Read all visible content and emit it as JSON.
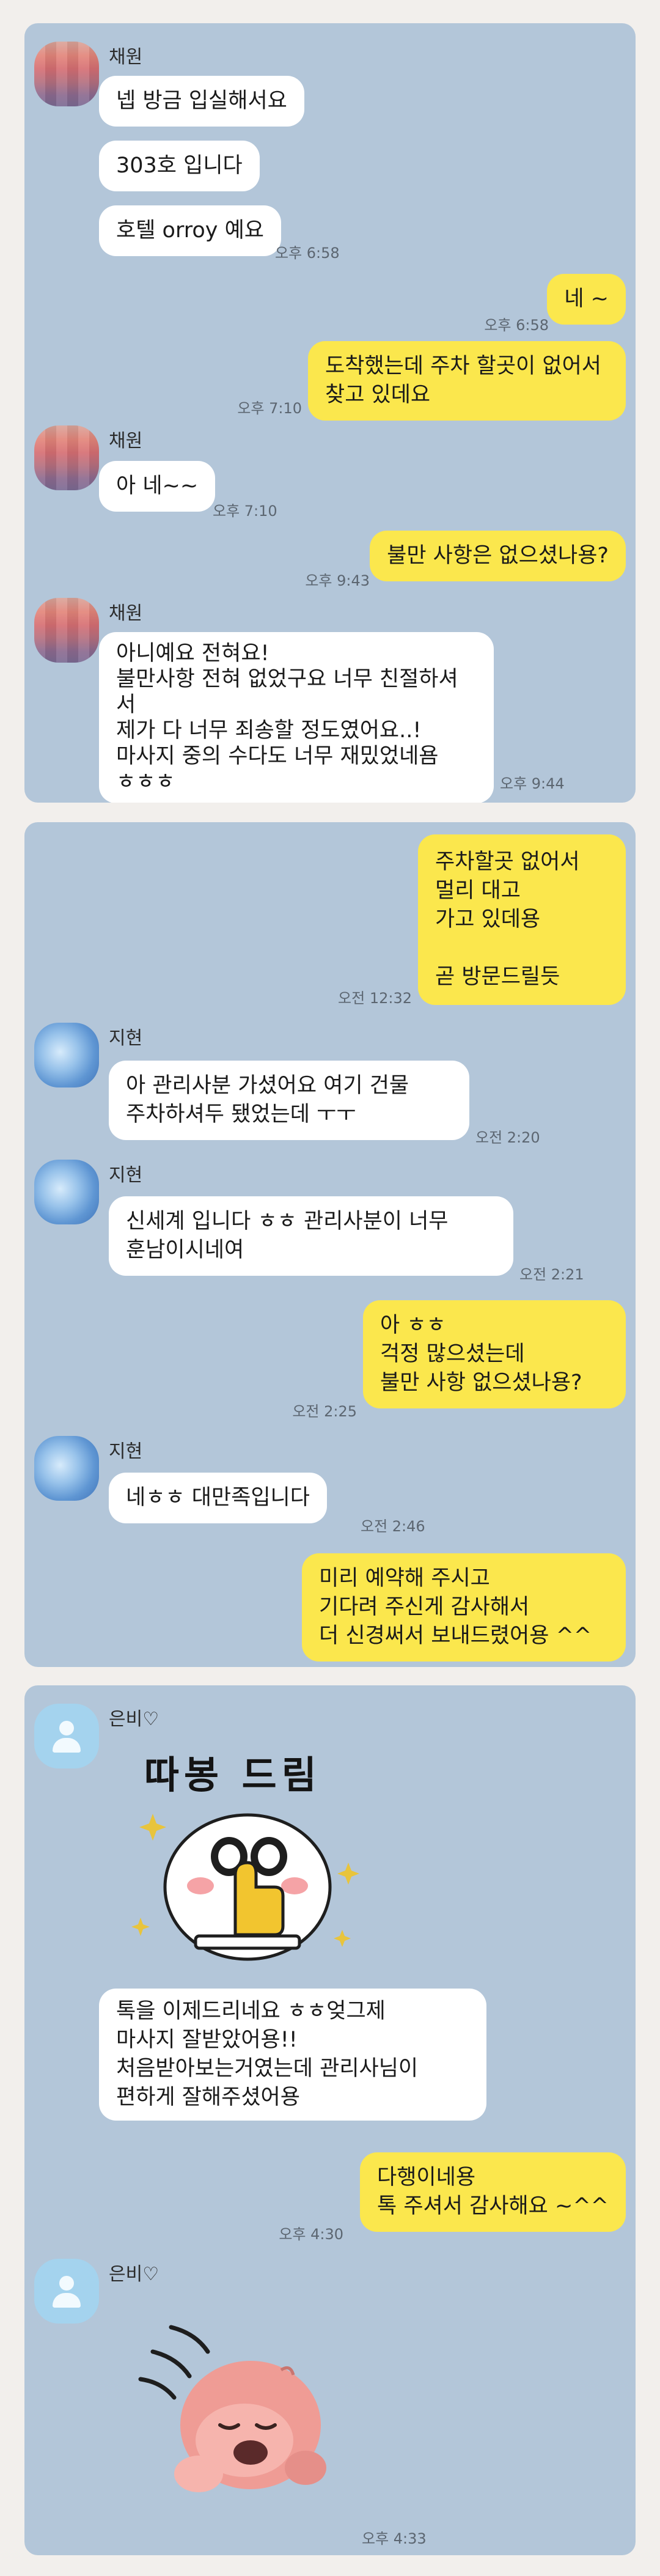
{
  "panel1": {
    "sender_name": "채원",
    "messages": {
      "m1": "넵 방금 입실해서요",
      "m2": "303호 입니다",
      "m3": "호텔 orroy 예요",
      "m3_time": "오후 6:58",
      "m4": "네 ~",
      "m4_time": "오후 6:58",
      "m5": "도착했는데  주차 할곳이 없어서\n찾고 있데요",
      "m5_time": "오후 7:10",
      "m6": "아 네~~",
      "m6_time": "오후 7:10",
      "m7": "불만 사항은 없으셨나용?",
      "m7_time": "오후 9:43",
      "m8": "아니예요 전혀요!\n불만사항 전혀 없었구요 너무 친절하셔서\n제가 다 너무 죄송할 정도였어요..!\n마사지 중의 수다도 너무 재밌었네욤\nㅎㅎㅎ",
      "m8_time": "오후 9:44"
    }
  },
  "panel2": {
    "sender_name": "지현",
    "messages": {
      "m1": "주차할곳 없어서\n멀리 대고\n가고 있데용\n\n곧 방문드릴듯",
      "m1_time": "오전 12:32",
      "m2": "아 관리사분 가셨어요 여기 건물\n주차하셔두 됐었는데 ㅜㅜ",
      "m2_time": "오전 2:20",
      "m3": "신세계 입니다 ㅎㅎ 관리사분이 너무\n훈남이시네여",
      "m3_time": "오전 2:21",
      "m4": "아 ㅎㅎ\n걱정 많으셨는데\n불만 사항 없으셨나용?",
      "m4_time": "오전 2:25",
      "m5": "네ㅎㅎ 대만족입니다",
      "m5_time": "오전 2:46",
      "m6": "미리 예약해 주시고\n기다려 주신게 감사해서\n더 신경써서 보내드렸어용 ^^"
    }
  },
  "panel3": {
    "sender_name": "은비♡",
    "sticker_caption": "따봉 드림",
    "messages": {
      "m1": "톡을 이제드리네요 ㅎㅎ엊그제\n마사지 잘받았어용!!\n처음받아보는거였는데 관리사님이\n편하게 잘해주셨어용",
      "m2": "다행이네용\n톡 주셔서 감사해요 ~^^",
      "m2_time": "오후 4:30",
      "m3_time": "오후 4:33"
    }
  },
  "colors": {
    "chat_background": "#b3c6d9",
    "outgoing_bubble": "#fbe74d",
    "incoming_bubble": "#ffffff",
    "page_background": "#f2efec"
  }
}
